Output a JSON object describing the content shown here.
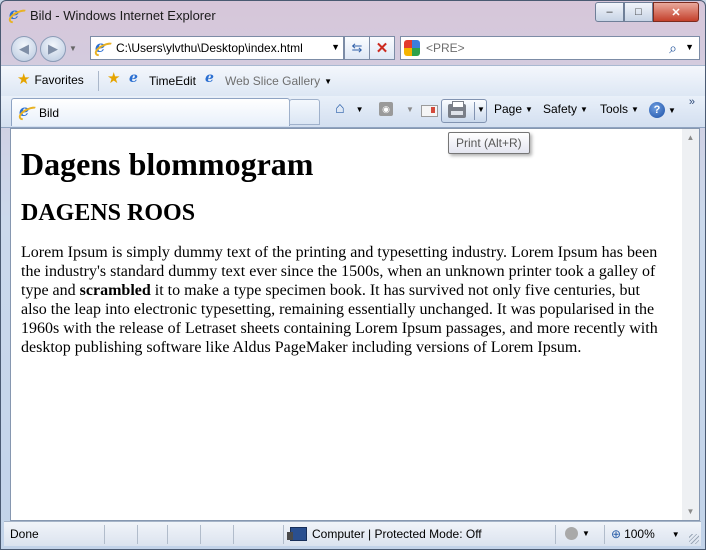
{
  "window": {
    "title": "Bild - Windows Internet Explorer",
    "minimize_glyph": "–",
    "maximize_glyph": "□",
    "close_glyph": "✕"
  },
  "navigation": {
    "back_glyph": "◀",
    "forward_glyph": "▶",
    "address": "C:\\Users\\ylvthu\\Desktop\\index.html",
    "refresh_glyph": "⇆",
    "stop_glyph": "✕",
    "search_placeholder": "<PRE>",
    "search_glyph": "⌕"
  },
  "favorites_bar": {
    "favorites_label": "Favorites",
    "items": [
      {
        "label": "TimeEdit"
      },
      {
        "label": "Web Slice Gallery"
      }
    ]
  },
  "tabs": [
    {
      "label": "Bild"
    }
  ],
  "command_bar": {
    "page_label": "Page",
    "safety_label": "Safety",
    "tools_label": "Tools",
    "help_glyph": "?",
    "more_glyph": "»"
  },
  "tooltip": {
    "text": "Print (Alt+R)"
  },
  "page": {
    "heading1": "Dagens blommogram",
    "heading2": "DAGENS ROOS",
    "paragraph_before_bold": "Lorem Ipsum is simply dummy text of the printing and typesetting industry. Lorem Ipsum has been the industry's standard dummy text ever since the 1500s, when an unknown printer took a galley of type and ",
    "paragraph_bold": "scrambled",
    "paragraph_after_bold": " it to make a type specimen book. It has survived not only five centuries, but also the leap into electronic typesetting, remaining essentially unchanged. It was popularised in the 1960s with the release of Letraset sheets containing Lorem Ipsum passages, and more recently with desktop publishing software like Aldus PageMaker including versions of Lorem Ipsum."
  },
  "status_bar": {
    "status_text": "Done",
    "zone_text": "Computer | Protected Mode: Off",
    "zoom": "100%"
  },
  "colors": {
    "accent": "#2b6fd1",
    "close_button": "#c4402b",
    "content_background": "#ffffff"
  }
}
